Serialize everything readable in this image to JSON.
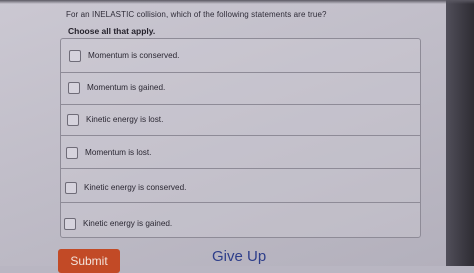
{
  "question": {
    "text": "For an INELASTIC collision, which of the following statements are true?",
    "instruction": "Choose all that apply."
  },
  "options": [
    {
      "label": "Momentum is conserved.",
      "checked": false
    },
    {
      "label": "Momentum is gained.",
      "checked": false
    },
    {
      "label": "Kinetic energy is lost.",
      "checked": false
    },
    {
      "label": "Momentum is lost.",
      "checked": false
    },
    {
      "label": "Kinetic energy is conserved.",
      "checked": false
    },
    {
      "label": "Kinetic energy is gained.",
      "checked": false
    }
  ],
  "actions": {
    "submit_label": "Submit",
    "give_up_label": "Give Up"
  },
  "colors": {
    "submit_bg": "#c24a26",
    "give_up_text": "#2e3e8a"
  }
}
